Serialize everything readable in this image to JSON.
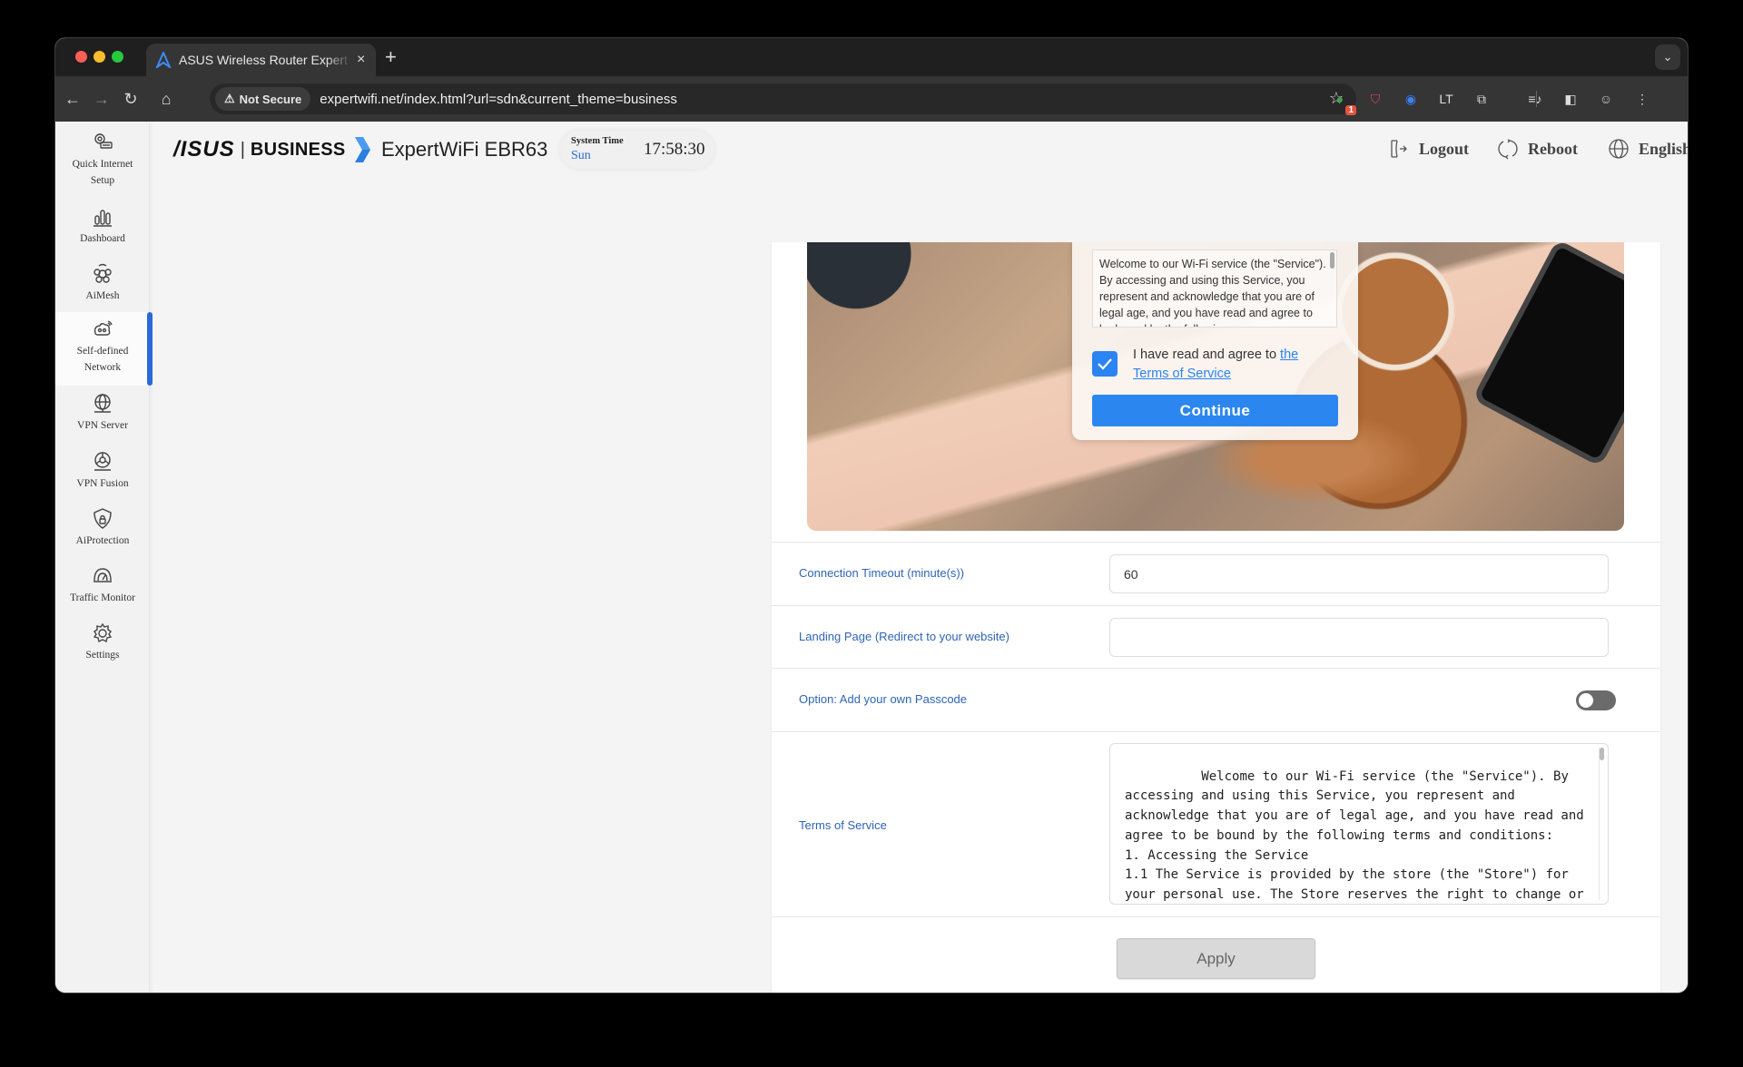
{
  "browser": {
    "tab_title": "ASUS Wireless Router Expert",
    "new_tab_label": "+",
    "tab_close_label": "×",
    "tab_search_label": "⌄",
    "security_label": "Not Secure",
    "url": "expertwifi.net/index.html?url=sdn&current_theme=business",
    "nav": {
      "back": "←",
      "forward": "→",
      "reload": "↻",
      "home": "⌂"
    },
    "star_label": "☆",
    "extensions": [
      {
        "name": "grammar-extension-icon",
        "glyph": "●",
        "color": "#3fa34d",
        "badge": "1"
      },
      {
        "name": "pocket-icon",
        "glyph": "⛉",
        "color": "#ef4056"
      },
      {
        "name": "password-manager-icon",
        "glyph": "◉",
        "color": "#3b82f6"
      },
      {
        "name": "language-tool-icon",
        "glyph": "LT",
        "color": "#dddddd"
      },
      {
        "name": "extensions-puzzle-icon",
        "glyph": "⧉",
        "color": "#dddddd"
      },
      {
        "name": "media-control-icon",
        "glyph": "≡♪",
        "color": "#dddddd"
      },
      {
        "name": "side-panel-icon",
        "glyph": "◧",
        "color": "#dddddd"
      },
      {
        "name": "profile-avatar",
        "glyph": "☺",
        "color": "#cccccc"
      },
      {
        "name": "menu-kebab-icon",
        "glyph": "⋮",
        "color": "#dddddd"
      }
    ]
  },
  "sidebar": {
    "items": [
      {
        "label": "Quick Internet Setup"
      },
      {
        "label": "Dashboard"
      },
      {
        "label": "AiMesh"
      },
      {
        "label": "Self-defined Network",
        "active": true
      },
      {
        "label": "VPN Server"
      },
      {
        "label": "VPN Fusion"
      },
      {
        "label": "AiProtection"
      },
      {
        "label": "Traffic Monitor"
      },
      {
        "label": "Settings"
      }
    ]
  },
  "header": {
    "brand": "/ISUS",
    "brand_separator": "|",
    "brand_line": "BUSINESS",
    "model": "ExpertWiFi EBR63",
    "system_time_label": "System Time",
    "day": "Sun",
    "time": "17:58:30",
    "logout_label": "Logout",
    "reboot_label": "Reboot",
    "language_label": "English",
    "accent_color": "#2a6ad8"
  },
  "preview": {
    "tos_excerpt": "Welcome to our Wi-Fi service (the \"Service\"). By accessing and using this Service, you represent and acknowledge that you are of legal age, and you have read and agree to be bound by the following",
    "agree_text": "I have read and agree to ",
    "agree_link": "the Terms of Service",
    "agree_checked": true,
    "continue_label": "Continue"
  },
  "form": {
    "timeout": {
      "label": "Connection Timeout (minute(s))",
      "value": "60"
    },
    "landing": {
      "label": "Landing Page (Redirect to your website)",
      "value": "",
      "placeholder": ""
    },
    "passcode": {
      "label": "Option: Add your own Passcode",
      "enabled": false
    },
    "tos": {
      "label": "Terms of Service",
      "value": "Welcome to our Wi-Fi service (the \"Service\"). By accessing and using this Service, you represent and acknowledge that you are of legal age, and you have read and agree to be bound by the following terms and conditions:\n1. Accessing the Service\n1.1 The Service is provided by the store (the \"Store\") for your personal use. The Store reserves the right to change or terminate the Service or change this Terms and Conditions at"
    },
    "apply_label": "Apply"
  }
}
